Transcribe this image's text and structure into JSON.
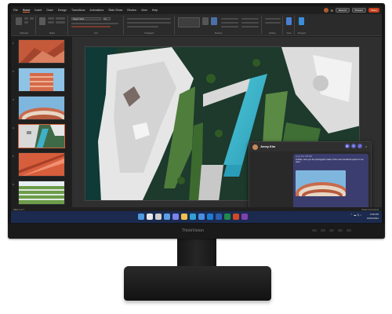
{
  "monitor": {
    "brand": "ThinkVision"
  },
  "app": {
    "menu": [
      "File",
      "Home",
      "Insert",
      "Draw",
      "Design",
      "Transitions",
      "Animations",
      "Slide Show",
      "Review",
      "View",
      "Help"
    ],
    "active_menu": "Home",
    "buttons": {
      "record": "Record",
      "present": "Present",
      "share": "Share"
    },
    "font_name": "Segoe Sans",
    "font_size": "11"
  },
  "ribbon": {
    "groups": [
      "Clipboard",
      "Slides",
      "Font",
      "Paragraph",
      "Drawing",
      "Editing",
      "Voice",
      "Designer"
    ]
  },
  "thumbnails": {
    "numbers": [
      "1",
      "2",
      "3",
      "4",
      "5",
      "6"
    ],
    "selected": 4
  },
  "chat": {
    "name": "Jenny Kim",
    "meta": "Jenny Kim  2:56 PM",
    "message": "Hi Mike, here you the photograph made of the most wonderful project in our team."
  },
  "statusbar": {
    "left": "Slide 4 of 7",
    "right": "Notes   Comments"
  },
  "taskbar": {
    "icons": [
      {
        "name": "start-icon",
        "color": "#4f9be0"
      },
      {
        "name": "search-icon",
        "color": "#e8e8e8"
      },
      {
        "name": "task-view-icon",
        "color": "#cfcfcf"
      },
      {
        "name": "widgets-icon",
        "color": "#5aa0e8"
      },
      {
        "name": "teams-icon",
        "color": "#7b83eb"
      },
      {
        "name": "explorer-icon",
        "color": "#f2c04a"
      },
      {
        "name": "edge-icon",
        "color": "#2fa0d8"
      },
      {
        "name": "store-icon",
        "color": "#4a90e2"
      },
      {
        "name": "outlook-icon",
        "color": "#1e7bd3"
      },
      {
        "name": "word-icon",
        "color": "#2b5fb5"
      },
      {
        "name": "excel-icon",
        "color": "#1f8a4c"
      },
      {
        "name": "powerpoint-icon",
        "color": "#d24726"
      },
      {
        "name": "onenote-icon",
        "color": "#8040b0"
      }
    ],
    "time": "2:56 PM",
    "date": "10/21/2021"
  }
}
